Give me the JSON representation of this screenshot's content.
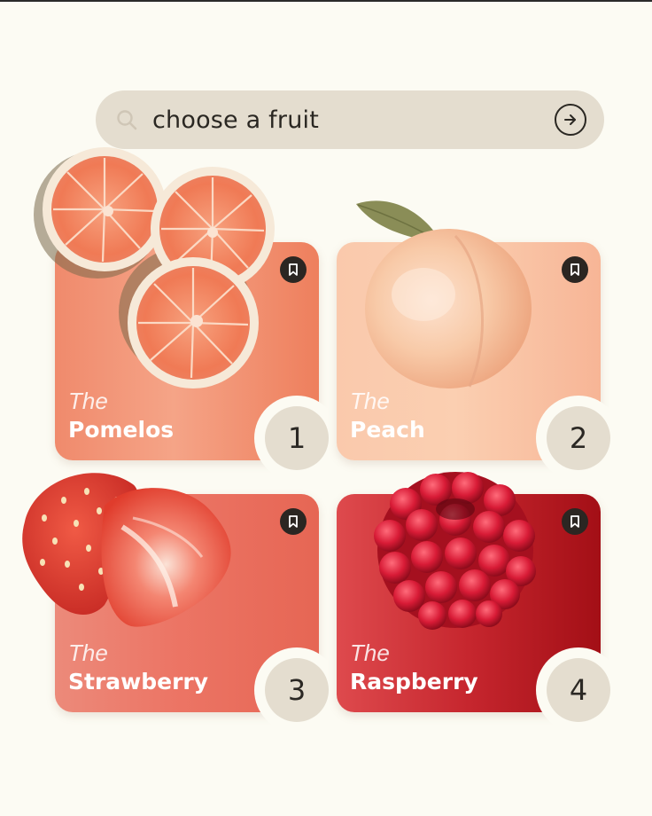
{
  "search": {
    "placeholder": "choose a fruit",
    "icon": "search-icon",
    "submit_icon": "arrow-right-circle-icon"
  },
  "cards": [
    {
      "prefix": "The",
      "name": "Pomelos",
      "number": "1",
      "image": "pomelo-slices"
    },
    {
      "prefix": "The",
      "name": "Peach",
      "number": "2",
      "image": "peach"
    },
    {
      "prefix": "The",
      "name": "Strawberry",
      "number": "3",
      "image": "strawberries"
    },
    {
      "prefix": "The",
      "name": "Raspberry",
      "number": "4",
      "image": "raspberry"
    }
  ],
  "colors": {
    "background": "#fcfbf3",
    "search_bg": "#e4ddcf",
    "pomelo_card": "#f08a6c",
    "peach_card": "#fbcfb1",
    "strawberry_card": "#ec7565",
    "raspberry_card": "#c6262e",
    "bookmark_bg": "#2b2622"
  }
}
